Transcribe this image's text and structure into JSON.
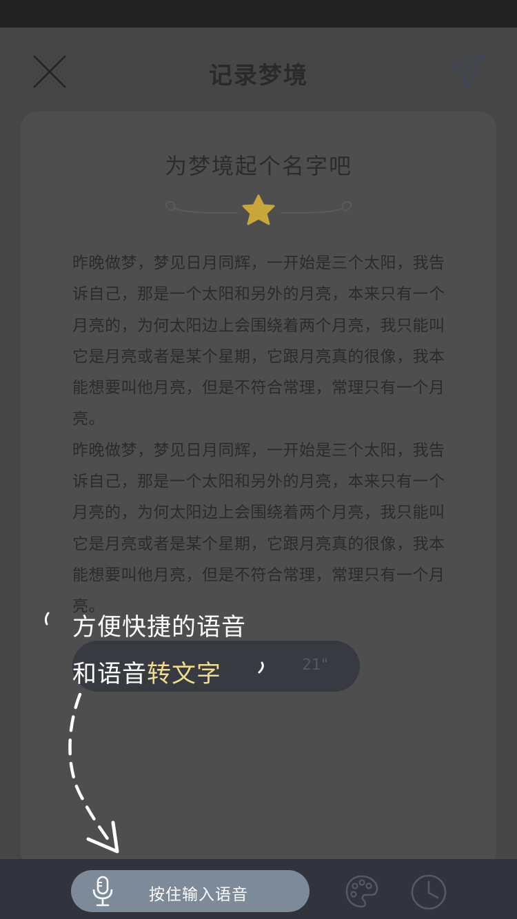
{
  "header": {
    "title": "记录梦境"
  },
  "dream": {
    "title_placeholder": "为梦境起个名字吧",
    "paragraphs": [
      "昨晚做梦，梦见日月同辉，一开始是三个太阳，我告诉自己，那是一个太阳和另外的月亮，本来只有一个月亮的，为何太阳边上会围绕着两个月亮，我只能叫它是月亮或者是某个星期，它跟月亮真的很像，我本能想要叫他月亮，但是不符合常理，常理只有一个月亮。",
      "昨晚做梦，梦见日月同辉，一开始是三个太阳，我告诉自己，那是一个太阳和另外的月亮，本来只有一个月亮的，为何太阳边上会围绕着两个月亮，我只能叫它是月亮或者是某个星期，它跟月亮真的很像，我本能想要叫他月亮，但是不符合常理，常理只有一个月亮。"
    ]
  },
  "voice_message": {
    "duration": "21\""
  },
  "hint": {
    "line1": "方便快捷的语音",
    "line2_prefix": "和语音",
    "line2_highlight": "转文字"
  },
  "bottom": {
    "voice_button_label": "按住输入语音"
  },
  "colors": {
    "highlight": "#f1dc8d",
    "star": "#c9a63a",
    "voice_button": "#7c8a99"
  },
  "icons": [
    "close-icon",
    "send-icon",
    "star-icon",
    "mic-icon",
    "palette-icon",
    "clock-icon"
  ]
}
